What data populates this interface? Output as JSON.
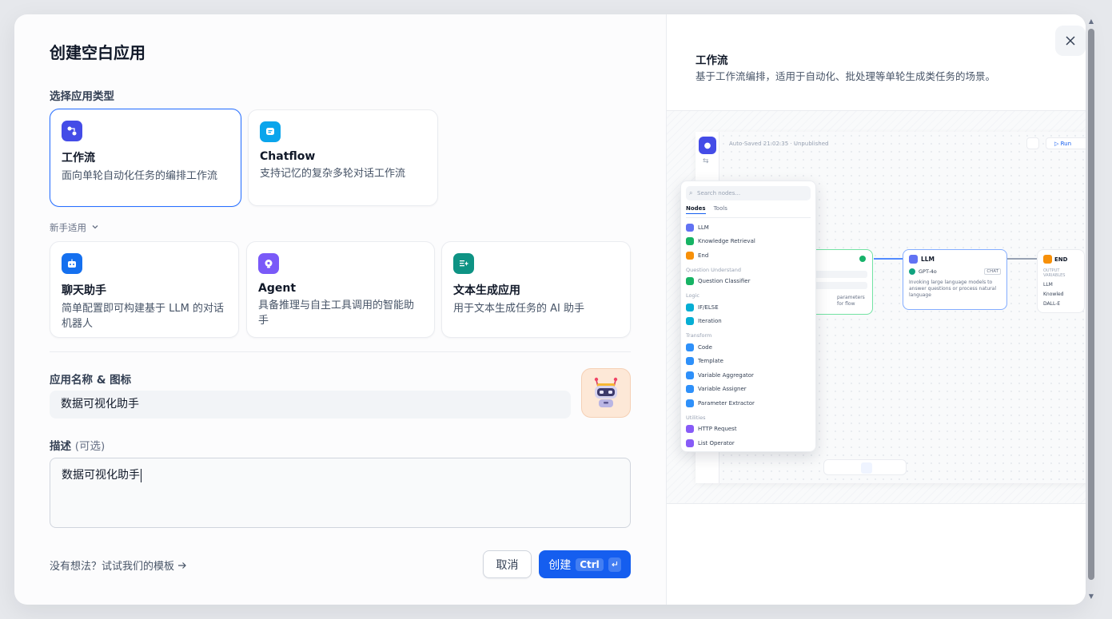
{
  "dialog": {
    "title": "创建空白应用",
    "type_section_label": "选择应用类型",
    "beginner_label": "新手适用",
    "name_section_label": "应用名称 & 图标",
    "name_value": "数据可视化助手",
    "desc_label": "描述",
    "desc_optional": "(可选)",
    "desc_value": "数据可视化助手",
    "template_link": "没有想法？试试我们的模板",
    "cancel_label": "取消",
    "create_label": "创建",
    "create_shortcut": "Ctrl"
  },
  "app_types": [
    {
      "title": "工作流",
      "desc": "面向单轮自动化任务的编排工作流",
      "icon": "workflow-icon",
      "color": "#444ce7",
      "selected": true
    },
    {
      "title": "Chatflow",
      "desc": "支持记忆的复杂多轮对话工作流",
      "icon": "chatflow-icon",
      "color": "#0ba5ec",
      "selected": false
    }
  ],
  "beginner_types": [
    {
      "title": "聊天助手",
      "desc": "简单配置即可构建基于 LLM 的对话机器人",
      "icon": "chatbot-icon",
      "color": "#1570ef"
    },
    {
      "title": "Agent",
      "desc": "具备推理与自主工具调用的智能助手",
      "icon": "agent-icon",
      "color": "#7a5af8"
    },
    {
      "title": "文本生成应用",
      "desc": "用于文本生成任务的 AI 助手",
      "icon": "text-generation-icon",
      "color": "#0e9384"
    }
  ],
  "preview": {
    "title": "工作流",
    "desc": "基于工作流编排，适用于自动化、批处理等单轮生成类任务的场景。",
    "autosave": "Auto-Saved 21:02:35 · Unpublished",
    "run_label": "Run",
    "search_placeholder": "Search nodes...",
    "tabs": [
      "Nodes",
      "Tools"
    ],
    "llm_node": {
      "title": "LLM",
      "model": "GPT-4o",
      "badge": "CHAT",
      "desc": "Invoking large language models to answer questions or process natural language"
    },
    "end_node": {
      "title": "END",
      "output": "OUTPUT VARIABLES",
      "items": [
        "LLM",
        "Knowled",
        "DALL-E"
      ]
    },
    "start_node_text": "parameters for flow",
    "node_list": [
      {
        "group": "",
        "items": [
          {
            "label": "LLM",
            "color": "#6172f3"
          },
          {
            "label": "Knowledge Retrieval",
            "color": "#16b364"
          },
          {
            "label": "End",
            "color": "#f79009"
          }
        ]
      },
      {
        "group": "Question Understand",
        "items": [
          {
            "label": "Question Classifier",
            "color": "#16b364"
          }
        ]
      },
      {
        "group": "Logic",
        "items": [
          {
            "label": "IF/ELSE",
            "color": "#06aed4"
          },
          {
            "label": "Iteration",
            "color": "#06aed4"
          }
        ]
      },
      {
        "group": "Transform",
        "items": [
          {
            "label": "Code",
            "color": "#2e90fa"
          },
          {
            "label": "Template",
            "color": "#2e90fa"
          },
          {
            "label": "Variable Aggregator",
            "color": "#2e90fa"
          },
          {
            "label": "Variable Assigner",
            "color": "#2e90fa"
          },
          {
            "label": "Parameter Extractor",
            "color": "#2e90fa"
          }
        ]
      },
      {
        "group": "Utilities",
        "items": [
          {
            "label": "HTTP Request",
            "color": "#875bf7"
          },
          {
            "label": "List Operator",
            "color": "#875bf7"
          }
        ]
      }
    ]
  }
}
